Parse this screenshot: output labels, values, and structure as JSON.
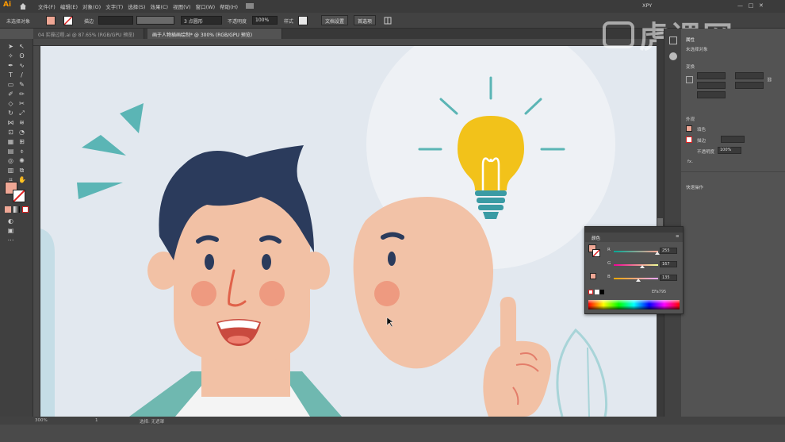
{
  "app": {
    "logo": "Ai",
    "menus": [
      "文件(F)",
      "编辑(E)",
      "对象(O)",
      "文字(T)",
      "选择(S)",
      "效果(C)",
      "视图(V)",
      "窗口(W)",
      "帮助(H)"
    ],
    "workspace": "XPY"
  },
  "control_bar": {
    "selection": "未选择对象",
    "stroke_label": "描边",
    "stroke_profile": "3 点圆形",
    "opacity_label": "不透明度",
    "opacity_value": "100%",
    "style_label": "样式",
    "doc_setup": "文档设置",
    "prefs": "首选项"
  },
  "tabs": [
    {
      "label": "04 实操过程.ai @ 87.65% (RGB/GPU 预览)",
      "active": false
    },
    {
      "label": "画于人物插画绘制* @ 300% (RGB/GPU 预览)",
      "active": true
    }
  ],
  "status": {
    "zoom": "300%",
    "artboard": "1",
    "info": "选择: 无遮罩"
  },
  "properties_panel": {
    "title": "属性",
    "sub": "未选择对象",
    "transform": "变换",
    "appearance": "外观",
    "fill": "填色",
    "stroke": "描边",
    "opacity": "不透明度",
    "opacity_value": "100%",
    "fx": "fx.",
    "quick_actions": "快速操作"
  },
  "color_panel": {
    "title": "颜色",
    "r_label": "R",
    "r_value": "255",
    "g_label": "G",
    "g_value": "167",
    "b_label": "B",
    "b_value": "135",
    "hex": "EFa795"
  },
  "watermark": "虎课网",
  "colors": {
    "fill": "#EFa795",
    "canvas_bg": "#e2e8ef",
    "hair": "#2b3b5c",
    "skin": "#f2c1a5",
    "bulb": "#f2c21a",
    "teal": "#5bb5b5"
  }
}
